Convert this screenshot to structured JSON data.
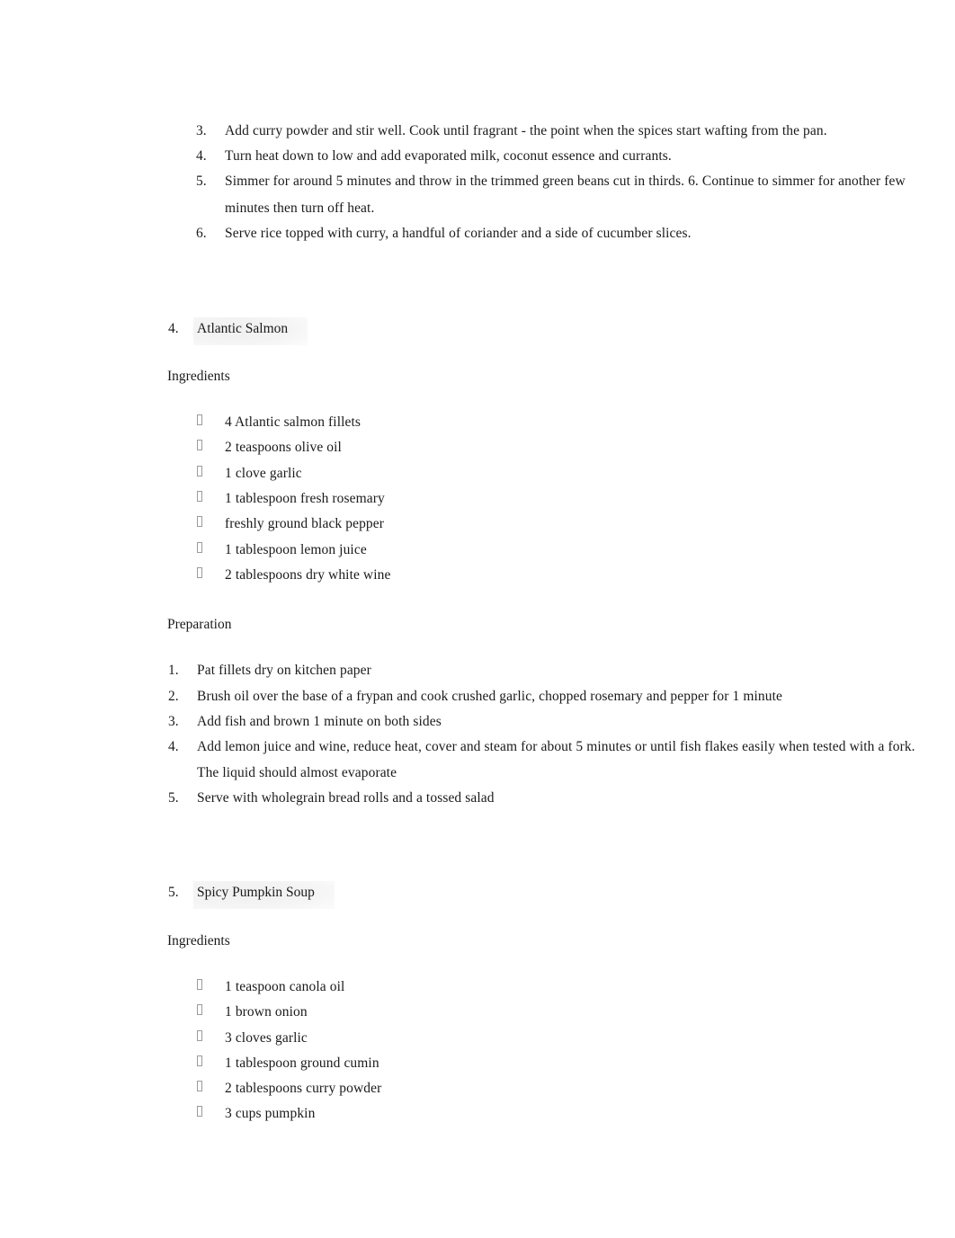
{
  "document": {
    "page_background": "#ffffff",
    "text_color": "#1a1a1a",
    "bullet_glyph": "missing-glyph-box"
  },
  "curry_steps": {
    "items": [
      {
        "number": "3.",
        "text": "Add curry powder and stir well. Cook until fragrant - the point when the spices start wafting from the pan."
      },
      {
        "number": "4.",
        "text": "Turn heat down to low and add evaporated milk, coconut essence and currants."
      },
      {
        "number": "5.",
        "text": "Simmer for around 5 minutes and throw in the trimmed green beans cut in thirds. 6. Continue to simmer for another few minutes then turn off heat."
      },
      {
        "number": "6.",
        "text": "Serve rice topped with curry, a handful of coriander and a side of cucumber slices."
      }
    ],
    "item5_line1": "Simmer for around 5 minutes and throw in the trimmed green beans cut in thirds. 6. Continue to simmer for another few",
    "item5_line2": "minutes then turn off heat."
  },
  "recipe_salmon": {
    "number": "4.",
    "title": "Atlantic Salmon",
    "ingredients_label": "Ingredients",
    "ingredients": [
      "4 Atlantic salmon fillets",
      "2 teaspoons olive oil",
      "1 clove garlic",
      "1 tablespoon fresh rosemary",
      "freshly ground black pepper",
      "1 tablespoon lemon juice",
      "2 tablespoons dry white wine"
    ],
    "preparation_label": "Preparation",
    "preparation": [
      {
        "number": "1.",
        "text": "Pat fillets dry on kitchen paper"
      },
      {
        "number": "2.",
        "text": "Brush oil over the base of a frypan and cook crushed garlic, chopped rosemary and pepper for 1 minute"
      },
      {
        "number": "3.",
        "text": "Add fish and brown 1 minute on both sides"
      },
      {
        "number": "4.",
        "text": "Add lemon juice and wine, reduce heat, cover and steam for about 5 minutes or until fish flakes easily when tested with a fork. The liquid should almost evaporate"
      },
      {
        "number": "5.",
        "text": "Serve with wholegrain bread rolls and a tossed salad"
      }
    ],
    "prep4_line1": "Add lemon juice and wine, reduce heat, cover and steam for about 5 minutes or until fish flakes easily when tested with a fork.",
    "prep4_line2": "The liquid should almost evaporate"
  },
  "recipe_pumpkin": {
    "number": "5.",
    "title": "Spicy Pumpkin Soup",
    "ingredients_label": "Ingredients",
    "ingredients": [
      "1 teaspoon canola oil",
      "1 brown onion",
      "3 cloves garlic",
      "1 tablespoon ground cumin",
      "2 tablespoons curry powder",
      "3 cups pumpkin"
    ]
  }
}
